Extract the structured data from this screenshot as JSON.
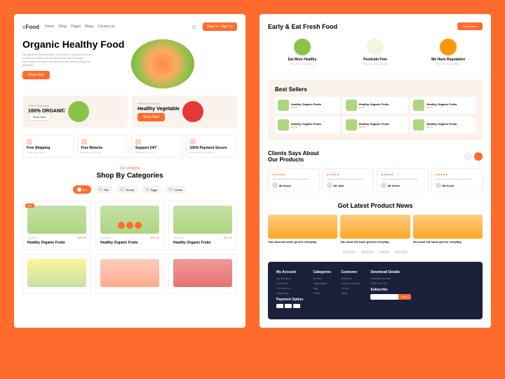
{
  "nav": {
    "logo_pre": "e",
    "logo": "Food",
    "links": [
      "Home",
      "Shop",
      "Pages",
      "Blogs",
      "Contact us"
    ],
    "signin": "Sign In / Sign up"
  },
  "hero": {
    "title": "Organic Healthy Food",
    "sub": "We again to those anyone who loves or pursues and/or desires to obtain itself because pain but because circumstances occur toil and pain him with some great pleasure.",
    "btn": "Shop Now",
    "bg": "Organic"
  },
  "promos": [
    {
      "label": "Green Vegetable",
      "title": "100% ORGANIC",
      "btn": "Shop Now"
    },
    {
      "label": "FRESH ORGANIC",
      "title": "Healthy Vegetable",
      "btn": "Shop Now"
    }
  ],
  "features": [
    {
      "t": "Free Shipping",
      "s": "On all order over £1"
    },
    {
      "t": "Free Returns",
      "s": "Returns within 7 days"
    },
    {
      "t": "Support 24/7",
      "s": "Contact us 24 / 7 hr"
    },
    {
      "t": "100% Payment Secure",
      "s": "Your payment safe with us"
    }
  ],
  "shop": {
    "label": "Our products",
    "title": "Shop By Categories"
  },
  "cats": [
    "Bio",
    "Fish",
    "Honey",
    "Eggs",
    "Cream"
  ],
  "products": [
    {
      "badge": "NEW",
      "cat": "Vegetables",
      "price": "$20.00",
      "name": "Healthy Organic Fruits"
    },
    {
      "badge": "",
      "cat": "Vegetables",
      "price": "$20.00",
      "name": "Healthy Organic Fruits",
      "actions": true
    },
    {
      "badge": "",
      "cat": "Vegetables",
      "price": "$20.00",
      "name": "Healthy Organic Fruits"
    }
  ],
  "eat": {
    "title": "Early & Eat Fresh Food",
    "btn": "Read More",
    "items": [
      {
        "t": "Eat More Healthy",
        "s": "There are many variations"
      },
      {
        "t": "Pesticide Free",
        "s": "There are many variations"
      },
      {
        "t": "We Have Reputation",
        "s": "There are many variations"
      }
    ]
  },
  "best": {
    "title": "Best Sellers",
    "items": [
      {
        "name": "Healthy Organic Fruits",
        "price": "$20.00"
      },
      {
        "name": "Healthy Organic Fruits",
        "price": "$20.00"
      },
      {
        "name": "Healthy Organic Fruits",
        "price": "$20.00"
      },
      {
        "name": "Healthy Organic Fruits",
        "price": "$20.00"
      },
      {
        "name": "Healthy Organic Fruits",
        "price": "$20.00"
      },
      {
        "name": "Healthy Organic Fruits",
        "price": "$20.00"
      }
    ]
  },
  "test": {
    "title": "Clients Says About Our Products",
    "items": [
      {
        "txt": "Lorem ipsum dolor sit amet consectetur",
        "name": "Mr Kevin"
      },
      {
        "txt": "Lorem ipsum dolor sit amet consectetur",
        "name": "Mr Jack"
      },
      {
        "txt": "Lorem ipsum dolor sit amet consectetur",
        "name": "Mr Kevin"
      },
      {
        "txt": "Lorem ipsum dolor sit amet consectetur",
        "name": "Mr Kevin"
      }
    ]
  },
  "news": {
    "title": "Got Latest Product News",
    "items": [
      {
        "t": "You must eat some greens everyday."
      },
      {
        "t": "You must eat some greens everyday."
      },
      {
        "t": "You must eat some greens everyday."
      }
    ]
  },
  "brands": [
    "BRAND",
    "BRAND",
    "UBER",
    "BRAND"
  ],
  "footer": {
    "cols": [
      {
        "h": "My Account",
        "l": [
          "My Account",
          "Checkout",
          "Contact Us",
          "Shopping"
        ]
      },
      {
        "h": "Categories",
        "l": [
          "Honey",
          "Vegetables",
          "Egg",
          "Fruits"
        ]
      },
      {
        "h": "Customer",
        "l": [
          "Reviews",
          "Custom Service",
          "Terms",
          "Shop"
        ]
      },
      {
        "h": "Download Details",
        "l": [
          "hello@food.com",
          "0000 111 222"
        ]
      }
    ],
    "pay": "Payment Option",
    "sub": "Subscribe",
    "subbtn": "Submit"
  }
}
